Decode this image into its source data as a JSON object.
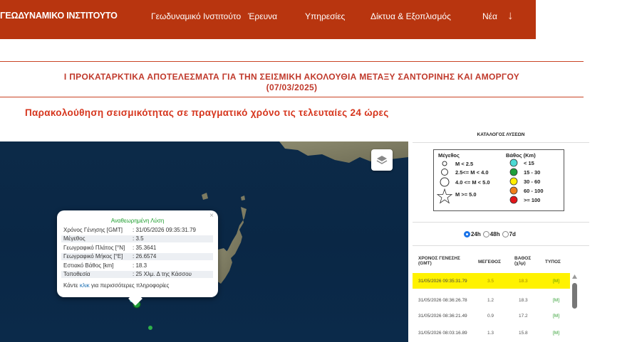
{
  "nav": {
    "brand": "ΓΕΩΔΥΝΑΜΙΚΟ ΙΝΣΤΙΤΟΥΤΟ",
    "items": [
      {
        "label": "Γεωδυναμικό Ινστιτούτο"
      },
      {
        "label": "Έρευνα"
      },
      {
        "label": "Υπηρεσίες"
      },
      {
        "label": "Δίκτυα & Εξοπλισμός"
      },
      {
        "label": "Νέα"
      }
    ],
    "arrow": "↓"
  },
  "page": {
    "title_line1": "Ι ΠΡΟΚΑΤΑΡΚΤΙΚΑ ΑΠΟΤΕΛΕΣΜΑΤΑ ΓΙΑ ΤΗΝ ΣΕΙΣΜΙΚΗ ΑΚΟΛΟΥΘΙΑ ΜΕΤΑΞΥ ΣΑΝΤΟΡΙΝΗΣ ΚΑΙ ΑΜΟΡΓΟΥ",
    "title_line2": "(07/03/2025)",
    "subtitle": "Παρακολούθηση σεισμικότητας σε πραγματικό χρόνο τις τελευταίες 24 ώρες"
  },
  "popup": {
    "close": "×",
    "title": "Αναθεωρημένη Λύση",
    "rows": [
      {
        "k": "Χρόνος Γένησης [GMT]",
        "v": ": 31/05/2026 09:35:31.79"
      },
      {
        "k": "Μέγεθος",
        "v": ": 3.5"
      },
      {
        "k": "Γεωγραφικό Πλάτος [°N]",
        "v": ": 35.3641"
      },
      {
        "k": "Γεωγραφικό Μήκος [°E]",
        "v": ": 26.6574"
      },
      {
        "k": "Εστιακό Βάθος [km]",
        "v": ": 18.3"
      },
      {
        "k": "Τοποθεσία",
        "v": ": 25 Χλμ. Δ της Κάσσου"
      }
    ],
    "foot_pre": "Κάντε ",
    "foot_link": "κλικ",
    "foot_post": " για περισσότερες πληροφορίες"
  },
  "legend": {
    "title": "ΚΑΤΑΛΟΓΟΣ ΛΥΣΕΩΝ",
    "mag_header": "Μέγεθος",
    "depth_header": "Βάθος (Km)",
    "mag_items": [
      "M < 2.5",
      "2.5<= M < 4.0",
      "4.0 <= M < 5.0",
      "M >= 5.0"
    ],
    "depth_items": [
      {
        "label": "< 15",
        "color": "#4dd9d4"
      },
      {
        "label": "15 - 30",
        "color": "#1e9e3a"
      },
      {
        "label": "30 - 60",
        "color": "#ffee00"
      },
      {
        "label": "60 - 100",
        "color": "#f07f1a"
      },
      {
        "label": ">= 100",
        "color": "#e3151a"
      }
    ]
  },
  "timefilter": {
    "options": [
      "24h",
      "48h",
      "7d"
    ],
    "selected": "24h"
  },
  "table": {
    "headers": {
      "time": "ΧΡΟΝΟΣ ΓΕΝΕΣΗΣ (GMT)",
      "mag": "ΜΕΓΕΘΟΣ",
      "depth": "ΒΑΘΟΣ (χλμ)",
      "type": "ΤΥΠΟΣ"
    },
    "rows": [
      {
        "time": "31/05/2026 09:35:31.79",
        "mag": "3.5",
        "depth": "18.3",
        "type": "[M]"
      },
      {
        "time": "31/05/2026 08:36:26.78",
        "mag": "1.2",
        "depth": "18.3",
        "type": "[M]"
      },
      {
        "time": "31/05/2026 08:36:21.49",
        "mag": "0.9",
        "depth": "17.2",
        "type": "[M]"
      },
      {
        "time": "31/05/2026 08:03:16.89",
        "mag": "1.3",
        "depth": "15.8",
        "type": "[M]"
      }
    ]
  }
}
